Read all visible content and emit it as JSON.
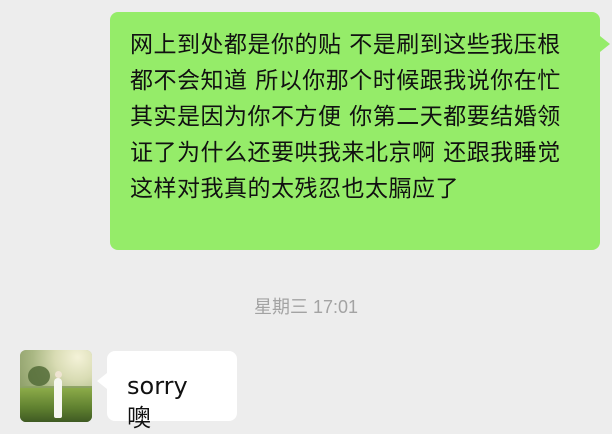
{
  "chat": {
    "outgoing_message": "网上到处都是你的贴 不是刷到这些我压根都不会知道 所以你那个时候跟我说你在忙其实是因为你不方便 你第二天都要结婚领证了为什么还要哄我来北京啊 还跟我睡觉  这样对我真的太残忍也太膈应了",
    "timestamp": "星期三 17:01",
    "incoming_message": "sorry 噢"
  },
  "colors": {
    "background": "#ededed",
    "outgoing_bubble": "#95ec69",
    "incoming_bubble": "#ffffff",
    "timestamp_text": "#a3a3a3"
  },
  "icons": {
    "avatar": "avatar-photo"
  }
}
